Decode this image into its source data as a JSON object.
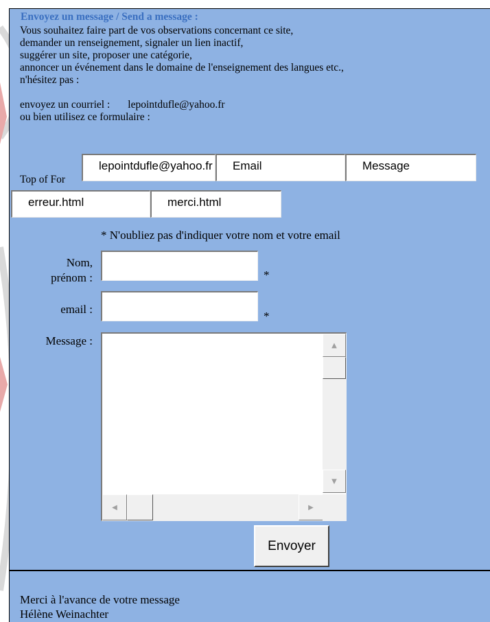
{
  "heading": "Envoyez un message / Send a message :",
  "intro_lines": [
    "Vous souhaitez faire part de vos observations concernant ce site,",
    "demander un renseignement, signaler un lien inactif,",
    "suggérer un site, proposer une catégorie,",
    "annoncer un événement dans le domaine de l'enseignement des langues etc.,",
    "n'hésitez pas :"
  ],
  "contact": {
    "email_label": "envoyez un courriel :",
    "email_address": "lepointdufle@yahoo.fr",
    "form_line": "ou bien utilisez ce formulaire :"
  },
  "top_of_form_label": "Top of For",
  "hidden_fields": {
    "recipient": "lepointdufle@yahoo.fr",
    "email": "Email",
    "message": "Message",
    "error_page": "erreur.html",
    "thanks_page": "merci.html"
  },
  "required_note": "* N'oubliez pas d'indiquer votre nom et votre email",
  "form": {
    "name_label_1": "Nom,",
    "name_label_2": "prénom :",
    "name_value": "",
    "email_label": "email :",
    "email_value": "",
    "message_label": "Message :",
    "message_value": "",
    "required_marker": "*",
    "submit_label": "Envoyer"
  },
  "footer": {
    "line1": "Merci à l'avance de votre message",
    "line2": "Hélène Weinachter"
  },
  "colors": {
    "panel_bg": "#8eb2e3",
    "heading": "#3a6fc0",
    "watermark_red": "#e8a9a9",
    "watermark_gray": "#d9d9d9"
  }
}
